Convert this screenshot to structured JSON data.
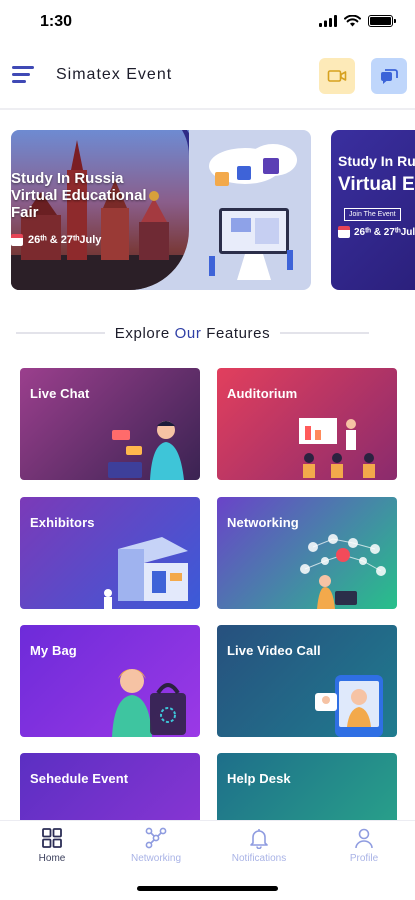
{
  "status_bar": {
    "time": "1:30"
  },
  "header": {
    "title": "Simatex Event"
  },
  "banners": [
    {
      "heading": "Study In Russia Virtual Educational Fair",
      "date": "26ᵗʰ & 27ᵗʰJuly"
    },
    {
      "heading_line1": "Study In Ru",
      "heading_line2": "Virtual E",
      "button_label": "Join The Event",
      "date": "26ᵗʰ & 27ᵗʰJuly"
    }
  ],
  "section": {
    "title_prefix": "Explore ",
    "title_accent": "Our",
    "title_suffix": " Features"
  },
  "features": [
    {
      "label": "Live Chat",
      "colors": [
        "#9b3f8d",
        "#3a2352"
      ]
    },
    {
      "label": "Auditorium",
      "colors": [
        "#e23f5d",
        "#8a2b6d"
      ]
    },
    {
      "label": "Exhibitors",
      "colors": [
        "#7b3ab8",
        "#3b5bd8"
      ]
    },
    {
      "label": "Networking",
      "colors": [
        "#6a43c9",
        "#27c08a"
      ]
    },
    {
      "label": "My Bag",
      "colors": [
        "#6d2bd9",
        "#9b39e6"
      ]
    },
    {
      "label": "Live Video Call",
      "colors": [
        "#27507e",
        "#1f7c8f"
      ]
    },
    {
      "label": "Sehedule Event",
      "colors": [
        "#5b2fc2",
        "#8e36d6"
      ]
    },
    {
      "label": "Help Desk",
      "colors": [
        "#1e6e8a",
        "#2aa88a"
      ]
    }
  ],
  "tabs": [
    {
      "label": "Home",
      "icon": "home-grid-icon",
      "active": true
    },
    {
      "label": "Networking",
      "icon": "network-icon",
      "active": false
    },
    {
      "label": "Notifications",
      "icon": "bell-icon",
      "active": false
    },
    {
      "label": "Profile",
      "icon": "user-icon",
      "active": false
    }
  ],
  "colors": {
    "brand": "#3f49b5",
    "tab_inactive": "#a9b3e6"
  }
}
